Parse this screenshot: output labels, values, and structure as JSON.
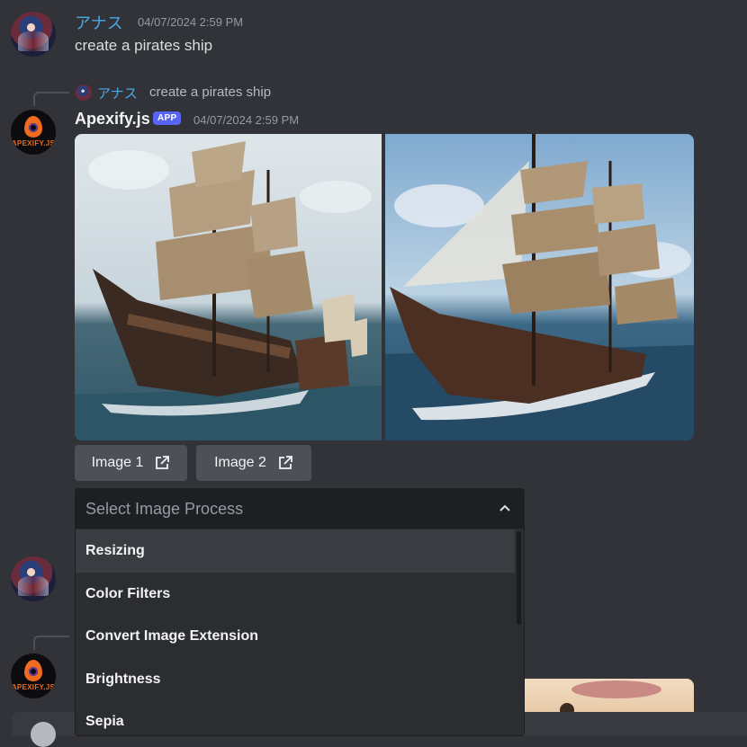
{
  "message1": {
    "username": "アナス",
    "timestamp": "04/07/2024 2:59 PM",
    "text": "create a pirates ship"
  },
  "message2": {
    "reply": {
      "username": "アナス",
      "text": "create a pirates ship"
    },
    "botname": "Apexify.js",
    "badge": "APP",
    "timestamp": "04/07/2024 2:59 PM",
    "bot_logo_text": "APEXIFY.JS",
    "buttons": [
      {
        "label": "Image 1",
        "icon": "external-link-icon"
      },
      {
        "label": "Image 2",
        "icon": "external-link-icon"
      }
    ]
  },
  "dropdown": {
    "placeholder": "Select Image Process",
    "options": [
      "Resizing",
      "Color Filters",
      "Convert Image Extension",
      "Brightness",
      "Sepia"
    ],
    "hovered": "Resizing"
  },
  "colors": {
    "background": "#313338",
    "username": "#4aa8e6",
    "badge": "#5865f2",
    "button": "#4e5058",
    "dropdown": "#2b2d31"
  }
}
